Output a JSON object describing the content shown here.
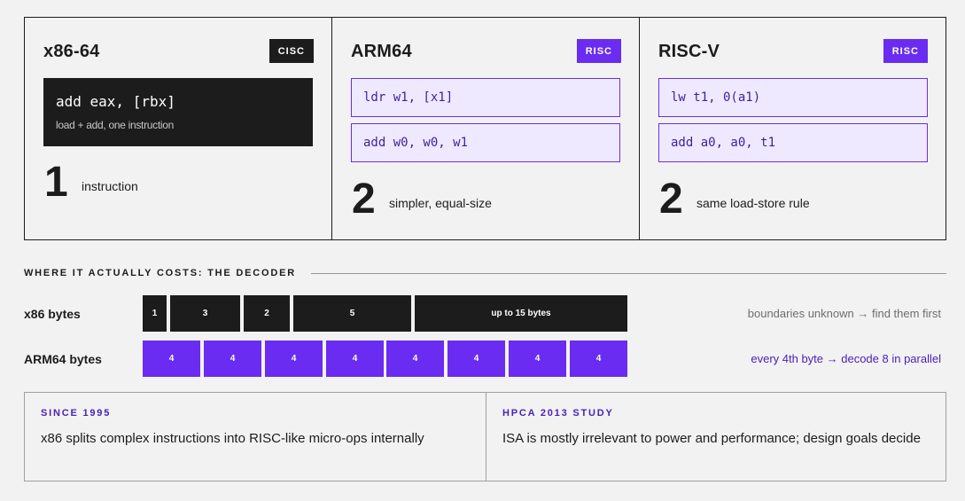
{
  "cards": [
    {
      "title": "x86-64",
      "badge": "CISC",
      "code": "add eax, [rbx]",
      "note": "load + add, one instruction",
      "count": "1",
      "count_label": "instruction"
    },
    {
      "title": "ARM64",
      "badge": "RISC",
      "lines": [
        "ldr w1, [x1]",
        "add w0, w0, w1"
      ],
      "count": "2",
      "count_label": "simpler, equal-size"
    },
    {
      "title": "RISC-V",
      "badge": "RISC",
      "lines": [
        "lw t1, 0(a1)",
        "add a0, a0, t1"
      ],
      "count": "2",
      "count_label": "same load-store rule"
    }
  ],
  "decoder": {
    "heading": "WHERE IT ACTUALLY COSTS: THE DECODER",
    "rows": [
      {
        "label": "x86 bytes",
        "segments": [
          "1",
          "3",
          "2",
          "5",
          "up to 15 bytes"
        ],
        "note": "boundaries unknown → find them first"
      },
      {
        "label": "ARM64 bytes",
        "segments": [
          "4",
          "4",
          "4",
          "4",
          "4",
          "4",
          "4",
          "4"
        ],
        "note": "every 4th byte → decode 8 in parallel"
      }
    ]
  },
  "facts": [
    {
      "kicker": "SINCE 1995",
      "text": "x86 splits complex instructions into RISC-like micro-ops internally"
    },
    {
      "kicker": "HPCA 2013 STUDY",
      "text": "ISA is mostly irrelevant to power and performance; design goals decide"
    }
  ],
  "colors": {
    "accent": "#6a2cf0",
    "dark": "#1c1c1c",
    "accent_text": "#4a22b8",
    "light_fill": "#efe9ff",
    "background": "#f2f2f2"
  }
}
